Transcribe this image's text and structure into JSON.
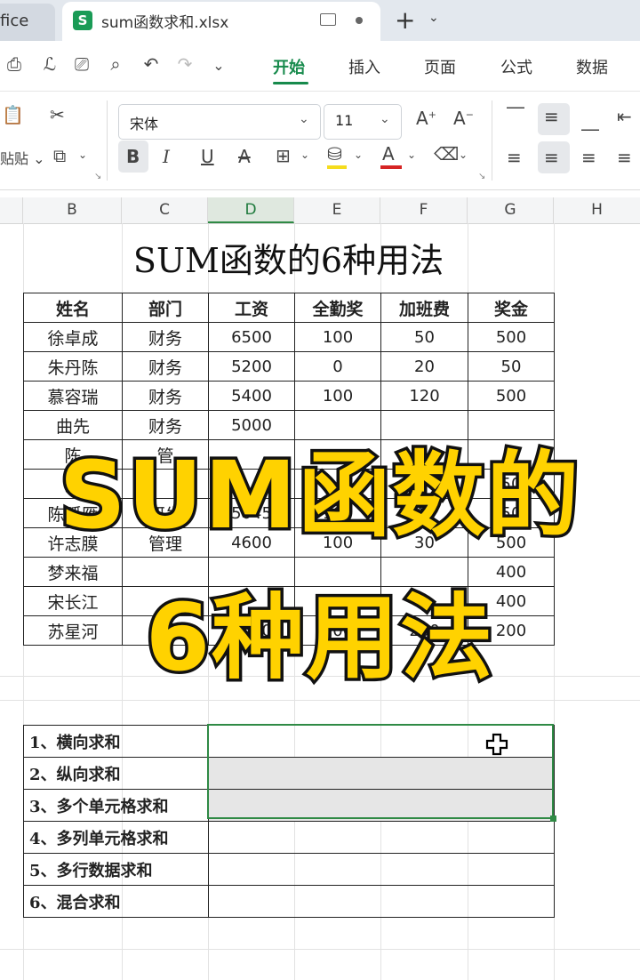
{
  "tabs": {
    "previous_partial": "fice",
    "active_title": "sum函数求和.xlsx",
    "app_logo_letter": "S"
  },
  "menu": {
    "items": [
      "开始",
      "插入",
      "页面",
      "公式",
      "数据"
    ],
    "active": "开始"
  },
  "ribbon": {
    "paste_label": "贴贴",
    "font_name": "宋体",
    "font_size": "11",
    "bold": "B",
    "italic": "I",
    "underline": "U",
    "strike": "A",
    "font_color_letter": "A",
    "font_grow": "A",
    "font_shrink": "A",
    "font_color": "#d62424",
    "highlight_color": "#f5dc1d"
  },
  "columns": [
    "B",
    "C",
    "D",
    "E",
    "F",
    "G",
    "H"
  ],
  "selected_column": "D",
  "sheet_title": "SUM函数的6种用法",
  "table": {
    "headers": [
      "姓名",
      "部门",
      "工资",
      "全勤奖",
      "加班费",
      "奖金"
    ],
    "rows": [
      [
        "徐卓成",
        "财务",
        "6500",
        "100",
        "50",
        "500"
      ],
      [
        "朱丹陈",
        "财务",
        "5200",
        "0",
        "20",
        "50"
      ],
      [
        "慕容瑞",
        "财务",
        "5400",
        "100",
        "120",
        "500"
      ],
      [
        "曲先",
        "财务",
        "5000",
        "",
        "",
        ""
      ],
      [
        "陈",
        "管",
        "",
        "",
        "",
        ""
      ],
      [
        "波",
        "",
        "",
        "",
        "",
        "50"
      ],
      [
        "陈孤雁",
        "研发",
        "5045",
        "100",
        "40",
        "50"
      ],
      [
        "许志膜",
        "管理",
        "4600",
        "100",
        "30",
        "500"
      ],
      [
        "梦来福",
        "",
        "",
        "",
        "",
        "400"
      ],
      [
        "宋长江",
        "",
        "",
        "",
        "",
        "400"
      ],
      [
        "苏星河",
        "财务",
        "5640",
        "100",
        "200",
        "200"
      ]
    ]
  },
  "methods": [
    "1、横向求和",
    "2、纵向求和",
    "3、多个单元格求和",
    "4、多列单元格求和",
    "5、多行数据求和",
    "6、混合求和"
  ],
  "overlay": {
    "line1": "SUM函数的",
    "line2": "6种用法",
    "fill_color": "#ffd200",
    "stroke_color": "#111111"
  },
  "accent_color": "#178a4c"
}
